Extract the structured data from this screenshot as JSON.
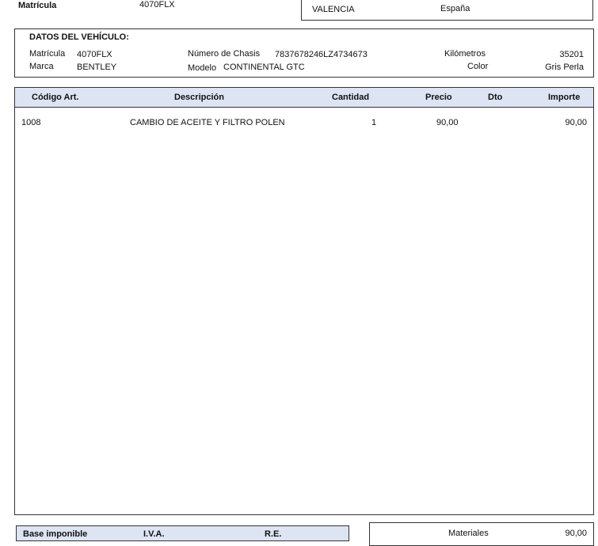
{
  "top": {
    "plate_label": "Matrícula",
    "plate_value": "4070FLX",
    "city": "VALENCIA",
    "country": "España"
  },
  "vehicle": {
    "section_title": "DATOS DEL VEHÍCULO:",
    "matricula_label": "Matrícula",
    "matricula_value": "4070FLX",
    "marca_label": "Marca",
    "marca_value": "BENTLEY",
    "chasis_label": "Número de Chasis",
    "chasis_value": "7837678246LZ4734673",
    "modelo_label": "Modelo",
    "modelo_value": "CONTINENTAL GTC",
    "km_label": "Kilómetros",
    "km_value": "35201",
    "color_label": "Color",
    "color_value": "Gris Perla"
  },
  "table": {
    "headers": [
      "Código Art.",
      "Descripción",
      "Cantidad",
      "Precio",
      "Dto",
      "Importe"
    ],
    "rows": [
      [
        "1008",
        "CAMBIO DE ACEITE Y FILTRO POLEN",
        "1",
        "90,00",
        "",
        "90,00"
      ]
    ]
  },
  "footer": {
    "base_label": "Base imponible",
    "iva_label": "I.V.A.",
    "re_label": "R.E.",
    "materiales_label": "Materiales",
    "materiales_value": "90,00"
  }
}
